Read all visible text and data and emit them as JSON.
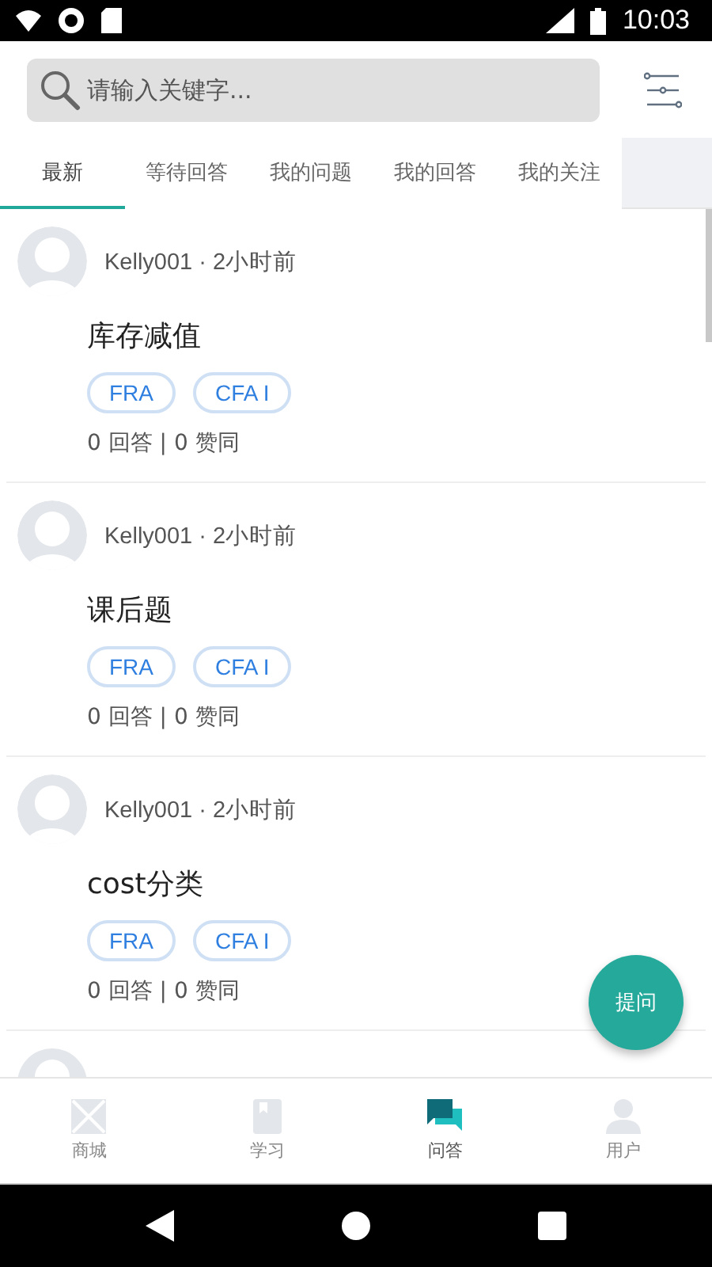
{
  "status_bar": {
    "time": "10:03"
  },
  "search": {
    "placeholder": "请输入关键字..."
  },
  "tabs": [
    {
      "label": "最新",
      "selected": true
    },
    {
      "label": "等待回答",
      "selected": false
    },
    {
      "label": "我的问题",
      "selected": false
    },
    {
      "label": "我的回答",
      "selected": false
    },
    {
      "label": "我的关注",
      "selected": false
    }
  ],
  "questions": [
    {
      "author": "Kelly001 · 2小时前",
      "title": "库存减值",
      "tags": [
        "FRA",
        "CFA I"
      ],
      "stats": "0 回答 | 0 赞同"
    },
    {
      "author": "Kelly001 · 2小时前",
      "title": "课后题",
      "tags": [
        "FRA",
        "CFA I"
      ],
      "stats": "0 回答 | 0 赞同"
    },
    {
      "author": "Kelly001 · 2小时前",
      "title": "cost分类",
      "tags": [
        "FRA",
        "CFA I"
      ],
      "stats": "0 回答 | 0 赞同"
    }
  ],
  "fab": {
    "label": "提问"
  },
  "bottom_nav": [
    {
      "label": "商城",
      "kind": "shop",
      "selected": false
    },
    {
      "label": "学习",
      "kind": "study",
      "selected": false
    },
    {
      "label": "问答",
      "kind": "qa",
      "selected": true
    },
    {
      "label": "用户",
      "kind": "user",
      "selected": false
    }
  ]
}
